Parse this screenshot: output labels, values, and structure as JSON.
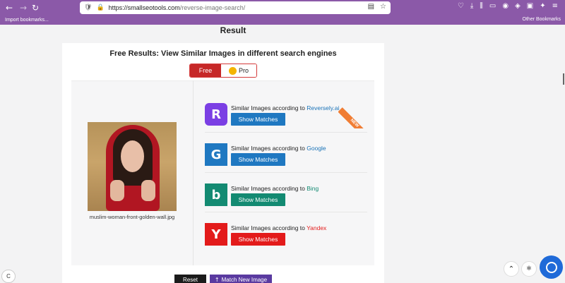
{
  "browser": {
    "url_host": "https://smallseotools.com",
    "url_path": "/reverse-image-search/",
    "bookmarks_import": "Import bookmarks...",
    "bookmarks_other": "Other Bookmarks"
  },
  "page": {
    "title": "Result",
    "heading": "Free Results: View Similar Images in different search engines",
    "toggle": {
      "free_label": "Free",
      "pro_label": "Pro"
    },
    "image_caption": "muslim-woman-front-golden-wall.jpg",
    "engines": [
      {
        "text": "Similar Images according to ",
        "name": "Reversely.ai",
        "name_color": "#1a73b8",
        "button_label": "Show Matches",
        "button_color": "#1f78c1",
        "logo_letter": "R",
        "logo_color": "#7b3fe4"
      },
      {
        "text": "Similar Images according to ",
        "name": "Google",
        "name_color": "#1a73b8",
        "button_label": "Show Matches",
        "button_color": "#1f78c1",
        "logo_letter": "G",
        "logo_color": "#1f78c1"
      },
      {
        "text": "Similar Images according to ",
        "name": "Bing",
        "name_color": "#138a72",
        "button_label": "Show Matches",
        "button_color": "#138a72",
        "logo_letter": "b",
        "logo_color": "#138a72"
      },
      {
        "text": "Similar Images according to ",
        "name": "Yandex",
        "name_color": "#e31b1b",
        "button_label": "Show Matches",
        "button_color": "#e31b1b",
        "logo_letter": "Y",
        "logo_color": "#e31b1b"
      }
    ],
    "new_ribbon": "NEW",
    "reset_label": "Reset",
    "match_new_label": "Match New Image"
  },
  "widgets": {
    "corner_label": "C"
  }
}
